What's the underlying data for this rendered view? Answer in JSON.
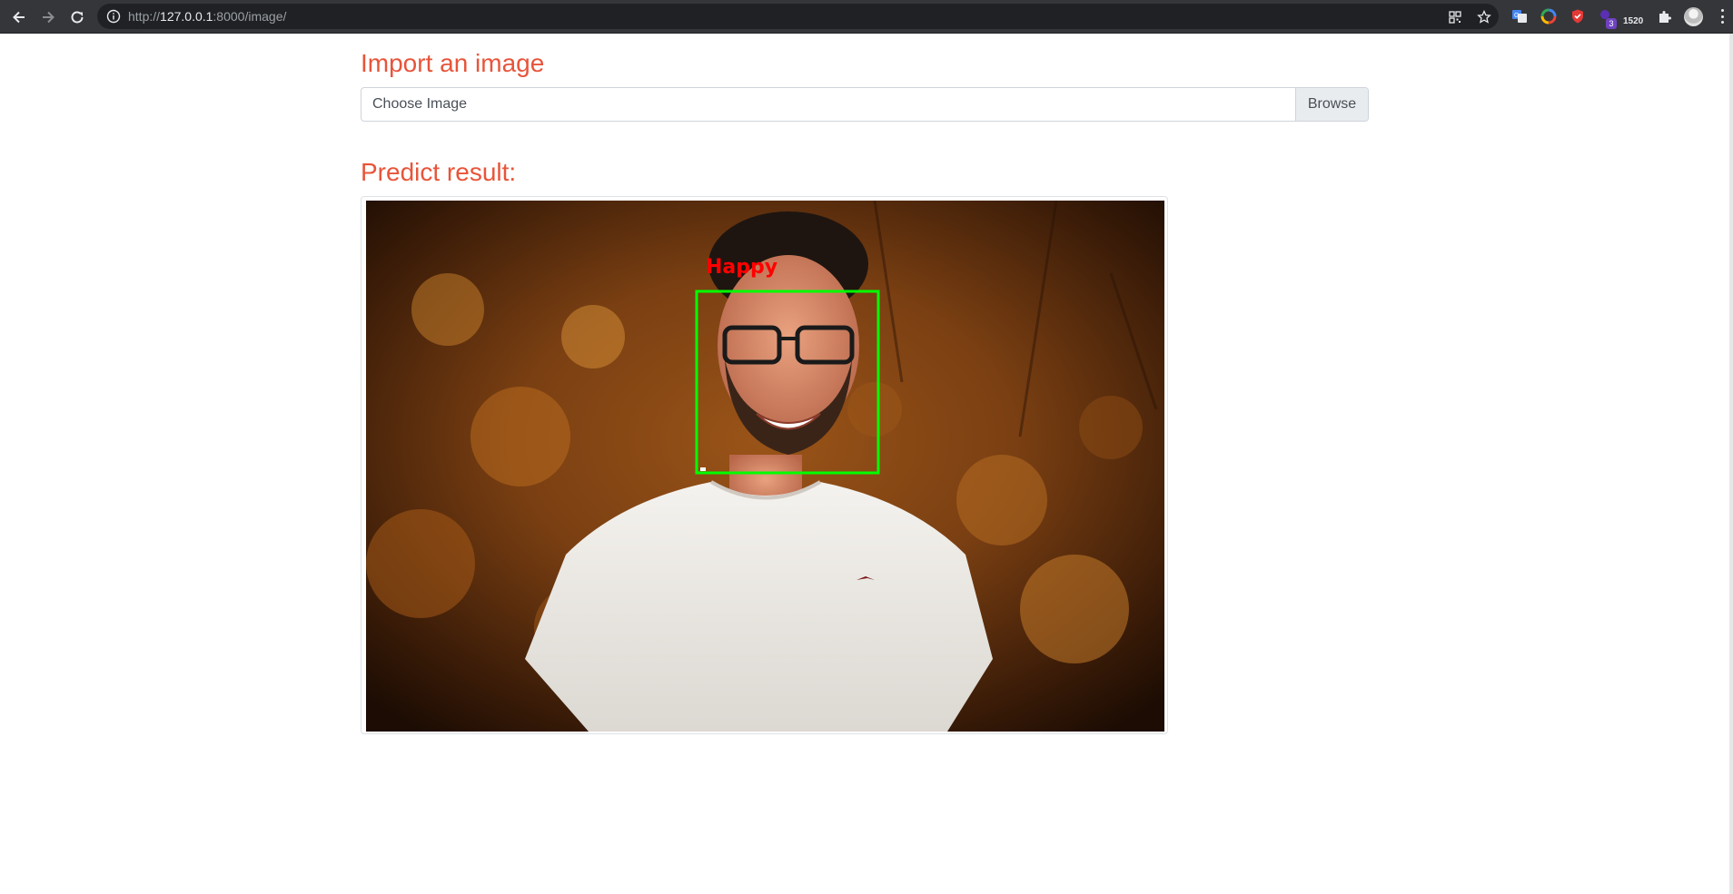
{
  "browser": {
    "url_scheme": "http://",
    "url_host": "127.0.0.1",
    "url_path": ":8000/image/",
    "extension_count": "1520",
    "extension_badge": "3",
    "icons": [
      "back-icon",
      "forward-icon",
      "reload-icon",
      "info-icon",
      "qr-code-icon",
      "bookmark-star-icon",
      "translate-icon",
      "color-wheel-icon",
      "shield-icon",
      "extension-icon",
      "puzzle-icon",
      "profile-avatar",
      "menu-icon"
    ]
  },
  "page": {
    "import_heading": "Import an image",
    "file_placeholder": "Choose Image",
    "browse_label": "Browse",
    "result_heading": "Predict result:"
  },
  "prediction": {
    "label": "Happy",
    "label_color": "#ff0000",
    "box_color": "#00ff00"
  },
  "colors": {
    "heading": "#e8543a",
    "toolbar": "#35363a",
    "omnibox": "#202124"
  }
}
